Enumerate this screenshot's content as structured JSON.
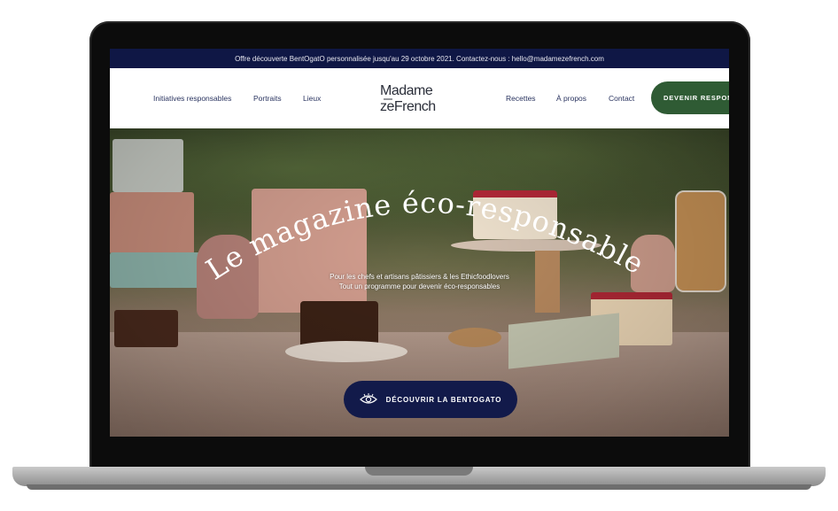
{
  "topbar": {
    "text": "Offre découverte BentOgatO personnalisée jusqu'au 29 octobre 2021. Contactez-nous : hello@madamezefrench.com"
  },
  "nav": {
    "left_links": [
      "Initiatives responsables",
      "Portraits",
      "Lieux"
    ],
    "right_links": [
      "Recettes",
      "À propos",
      "Contact"
    ],
    "cta_label": "DEVENIR RESPON",
    "logo_line1": "Madame",
    "logo_line2": "zeFrench"
  },
  "hero": {
    "title": "Le magazine éco-responsable",
    "subtitle_line1": "Pour les chefs et artisans pâtissiers & les Ethicfoodlovers",
    "subtitle_line2": "Tout un programme pour devenir éco-responsables",
    "button_label": "DÉCOUVRIR LA BENTOGATO",
    "button_icon": "eye-icon"
  },
  "colors": {
    "topbar_bg": "#0f1745",
    "cta_green": "#2f5b34",
    "hero_button_navy": "#121a4a",
    "nav_text": "#2a3460"
  }
}
